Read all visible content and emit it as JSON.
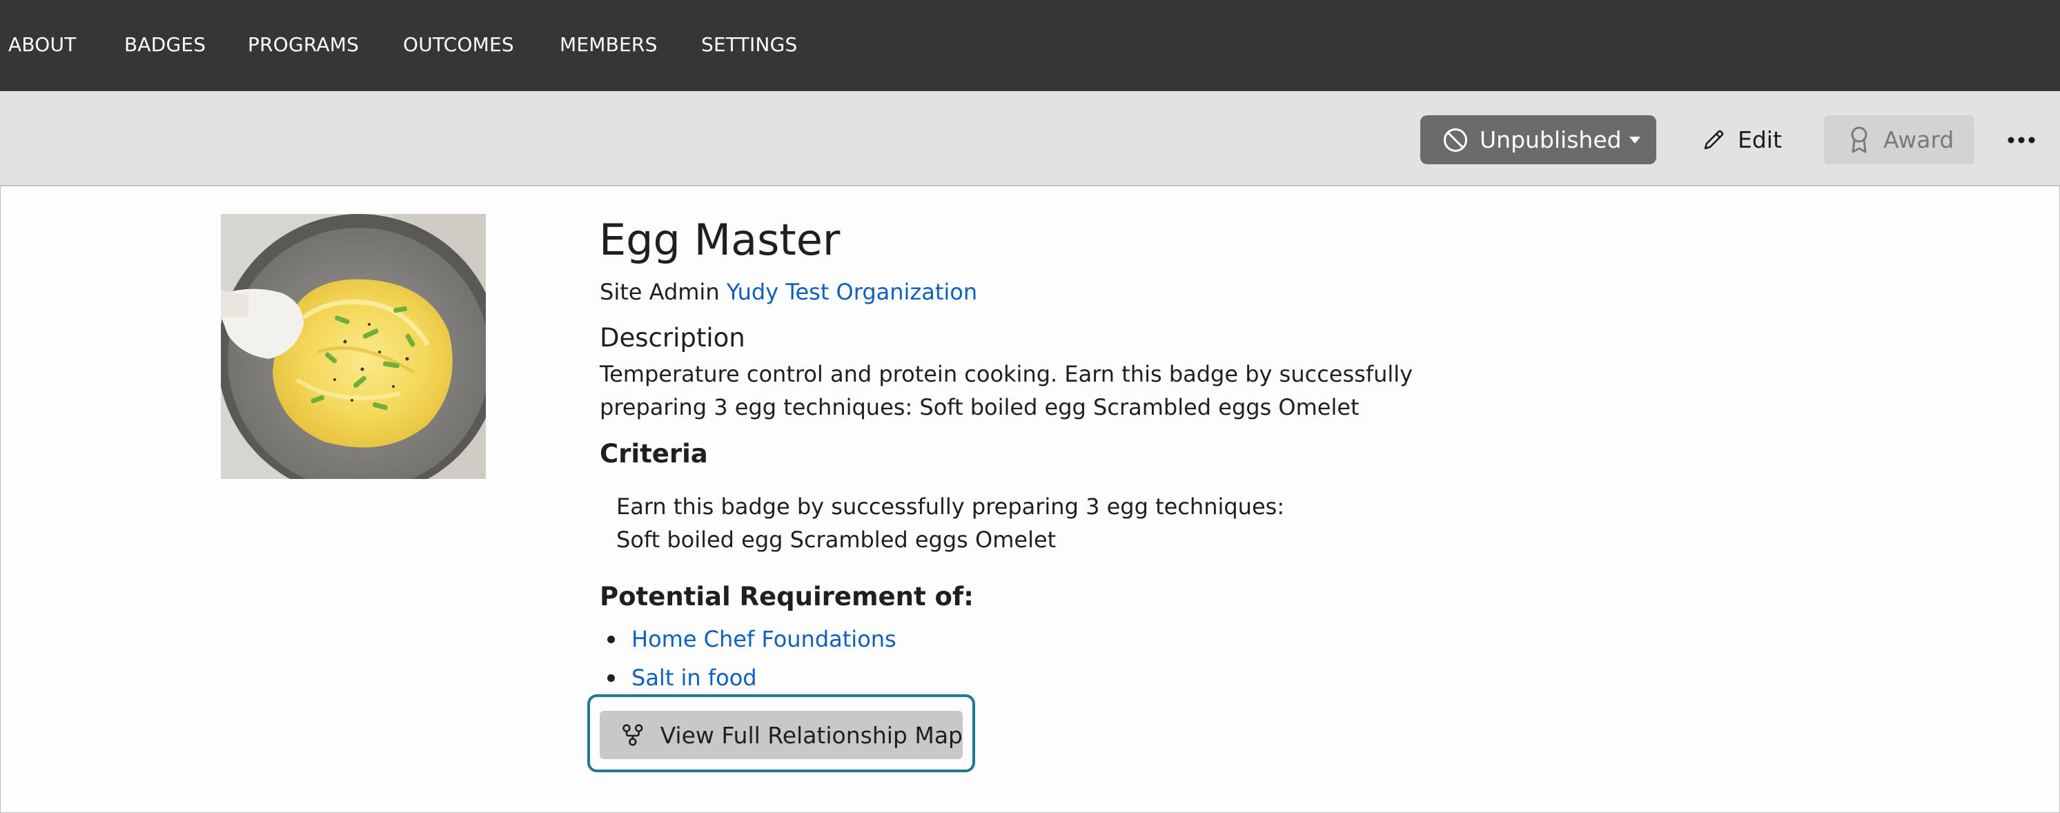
{
  "nav": {
    "items": [
      {
        "label": "ABOUT"
      },
      {
        "label": "BADGES"
      },
      {
        "label": "PROGRAMS"
      },
      {
        "label": "OUTCOMES"
      },
      {
        "label": "MEMBERS"
      },
      {
        "label": "SETTINGS"
      }
    ]
  },
  "actions": {
    "status_label": "Unpublished",
    "edit_label": "Edit",
    "award_label": "Award"
  },
  "badge": {
    "title": "Egg Master",
    "issuer_prefix": "Site Admin",
    "issuer_link": "Yudy Test Organization",
    "description_heading": "Description",
    "description_lines": [
      "Temperature control and protein cooking. Earn this badge by successfully",
      "preparing 3 egg techniques: Soft boiled egg Scrambled eggs Omelet"
    ],
    "criteria_heading": "Criteria",
    "criteria_lines": [
      "Earn this badge by successfully preparing 3 egg techniques:",
      "Soft boiled egg Scrambled eggs Omelet"
    ],
    "requirement_heading": "Potential Requirement of:",
    "requirements": [
      {
        "label": "Home Chef Foundations"
      },
      {
        "label": "Salt in food"
      }
    ],
    "map_button_label": "View Full Relationship Map"
  },
  "colors": {
    "nav_bg": "#363636",
    "actionbar_bg": "#e2e2e2",
    "link": "#0f5fbf",
    "status_button_bg": "#6b6b6b",
    "focus_ring": "#1f7a8c"
  },
  "icons": {
    "status": "prohibited-icon",
    "status_dropdown": "caret-down-icon",
    "edit": "pencil-icon",
    "award": "ribbon-icon",
    "more": "more-horizontal-icon",
    "map": "relationship-map-icon"
  }
}
